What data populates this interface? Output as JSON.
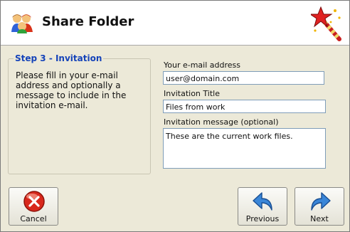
{
  "window": {
    "title": "Share Folder"
  },
  "step": {
    "title": "Step 3 - Invitation",
    "description": "Please fill in your e-mail address and optionally a message to include in the invitation e-mail."
  },
  "form": {
    "email_label": "Your e-mail address",
    "email_value": "user@domain.com",
    "title_label": "Invitation Title",
    "title_value": "Files from work",
    "message_label": "Invitation message (optional)",
    "message_value": "These are the current work files."
  },
  "buttons": {
    "cancel": "Cancel",
    "previous": "Previous",
    "next": "Next"
  },
  "icons": {
    "header": "users-share-icon",
    "wizard": "magic-wand-icon",
    "cancel": "cancel-icon",
    "previous": "previous-arrow-icon",
    "next": "next-arrow-icon"
  }
}
